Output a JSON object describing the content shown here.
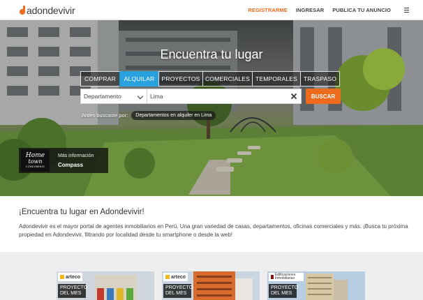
{
  "header": {
    "logo_text": "adondevivir",
    "nav": {
      "register": "REGISTRARME",
      "login": "INGRESAR",
      "publish": "PUBLICA TU ANUNCIO"
    },
    "accent_color": "#ee6b1e"
  },
  "hero": {
    "title": "Encuentra tu lugar",
    "tabs": [
      "COMPRAR",
      "ALQUILAR",
      "PROYECTOS",
      "COMERCIALES",
      "TEMPORALES",
      "TRASPASO"
    ],
    "active_tab": "ALQUILAR",
    "active_color": "#29a1dd",
    "property_type": "Departamento",
    "location_value": "Lima",
    "search_button": "BUSCAR",
    "recent_label": "Antes buscaste por:",
    "recent_chip": "Departamentos en alquiler en Lima",
    "promo": {
      "logo_line1": "Home",
      "logo_line2": "town",
      "logo_line3": "CONDOMINIO",
      "more_info": "Más información",
      "company": "Compass"
    }
  },
  "intro": {
    "heading": "¡Encuentra tu lugar en Adondevivir!",
    "body": "Adondevivir es el mayor portal de agentes inmobiliarios en Perú. Una gran variedad de casas, departamentos, oficinas comerciales y más. ¡Busca tu próxima propiedad en Adondevivir, filtrando por localidad desde tu smartphone o desde la web!"
  },
  "featured": [
    {
      "brand": "arteco",
      "tag": "PROYECTO DEL MES"
    },
    {
      "brand": "arteco",
      "tag": "PROYECTO DEL MES"
    },
    {
      "brand": "Edificaciones Inmobiliarias",
      "tag": "PROYECTO DEL MES"
    }
  ]
}
